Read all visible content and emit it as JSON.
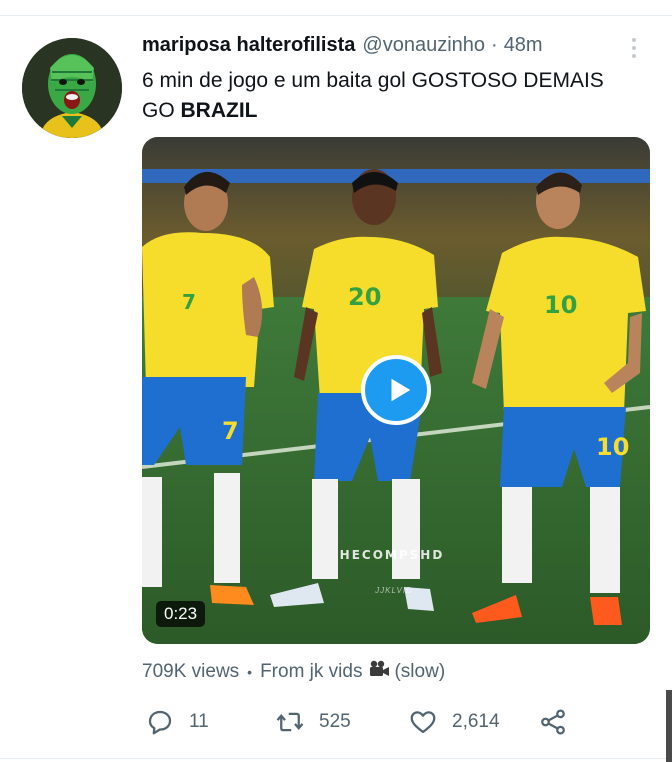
{
  "tweet": {
    "author_name": "mariposa halterofilista",
    "author_handle": "@vonauzinho",
    "separator": "·",
    "time": "48m",
    "text_line1": "6 min de jogo e um baita gol GOSTOSO DEMAIS",
    "text_line2_prefix": "GO ",
    "text_line2_bold": "BRAZIL"
  },
  "media": {
    "type": "video",
    "duration": "0:23",
    "watermark": "HECOMPSHD",
    "watermark_small": "JJKLVID",
    "player_jersey_numbers": [
      "7",
      "20",
      "10"
    ]
  },
  "meta": {
    "views": "709K views",
    "separator": "•",
    "source_prefix": "From jk vids",
    "camera_icon": "movie-camera-icon",
    "source_suffix": "(slow)"
  },
  "actions": {
    "replies": "11",
    "retweets": "525",
    "likes": "2,614"
  },
  "colors": {
    "accent": "#1d9bf0",
    "text_primary": "#0f1419",
    "text_secondary": "#536471",
    "jersey_yellow": "#f6dc2b",
    "shorts_blue": "#1f6fd1"
  }
}
